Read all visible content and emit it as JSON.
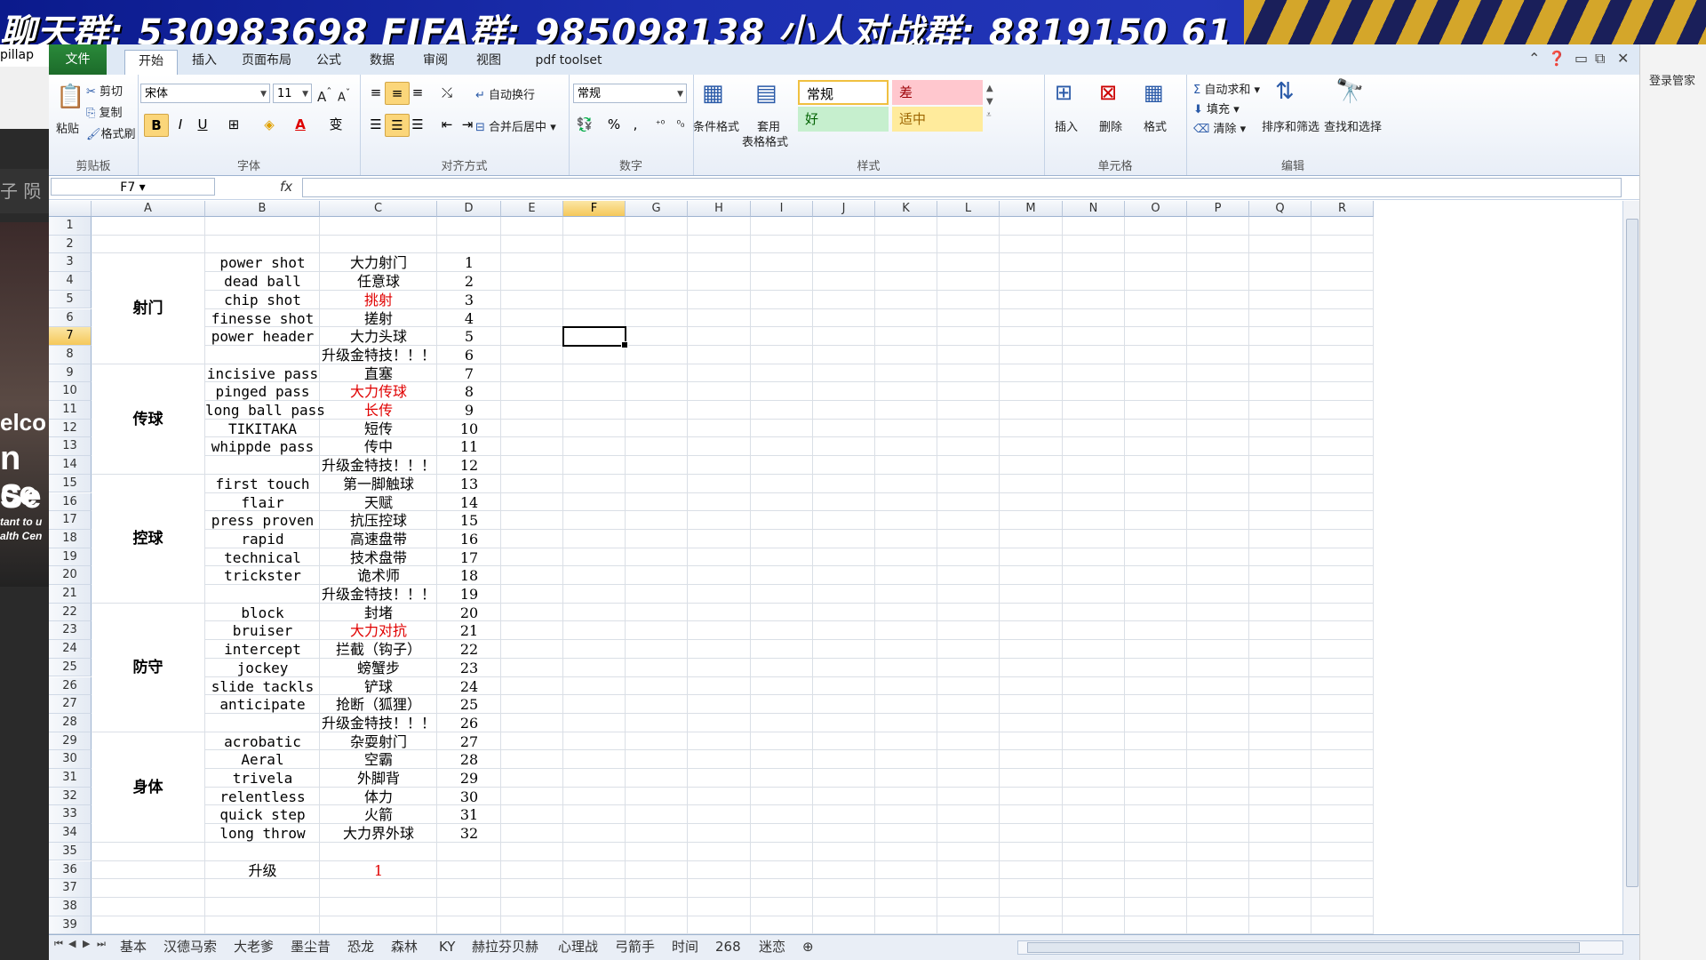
{
  "banner": {
    "text": "聊天群: 530983698   FIFA群: 985098138   小人对战群: 8819150 61"
  },
  "left_bg": {
    "label": "pillap",
    "sidebar_chars": "子  陨",
    "web_text": [
      "elco",
      "n Se",
      "ce",
      "tant to u",
      "alth Cen"
    ]
  },
  "right_bg": {
    "label": "登录管家"
  },
  "ribbon": {
    "file_label": "文件",
    "tabs": [
      "开始",
      "插入",
      "页面布局",
      "公式",
      "数据",
      "审阅",
      "视图",
      "pdf toolset"
    ],
    "active_tab": "开始",
    "clipboard": {
      "paste": "粘贴",
      "cut": "剪切",
      "copy": "复制",
      "format_painter": "格式刷",
      "label": "剪贴板"
    },
    "font": {
      "name": "宋体",
      "size": "11",
      "label": "字体",
      "bold": "B",
      "italic": "I",
      "underline": "U",
      "font_color": "A",
      "wen": "变"
    },
    "alignment": {
      "wrap": "自动换行",
      "merge": "合并后居中",
      "label": "对齐方式"
    },
    "number": {
      "format": "常规",
      "percent": "%",
      "comma": ",",
      "label": "数字"
    },
    "styles": {
      "conditional": "条件格式",
      "table_format_1": "套用",
      "table_format_2": "表格格式",
      "normal": "常规",
      "bad": "差",
      "good": "好",
      "neutral": "适中",
      "label": "样式"
    },
    "cells": {
      "insert": "插入",
      "delete": "删除",
      "format": "格式",
      "label": "单元格"
    },
    "editing": {
      "autosum": "自动求和",
      "fill": "填充",
      "clear": "清除",
      "sort": "排序和筛选",
      "find": "查找和选择",
      "label": "编辑"
    }
  },
  "formula_bar": {
    "name_box": "F7",
    "fx": "fx",
    "value": ""
  },
  "columns": [
    "A",
    "B",
    "C",
    "D",
    "E",
    "F",
    "G",
    "H",
    "I",
    "J",
    "K",
    "L",
    "M",
    "N",
    "O",
    "P",
    "Q",
    "R"
  ],
  "selected_column": "F",
  "selected_row": 7,
  "rows": [
    "1",
    "2",
    "3",
    "4",
    "5",
    "6",
    "7",
    "8",
    "9",
    "10",
    "11",
    "12",
    "13",
    "14",
    "15",
    "16",
    "17",
    "18",
    "19",
    "20",
    "21",
    "22",
    "23",
    "24",
    "25",
    "26",
    "27",
    "28",
    "29",
    "30",
    "31",
    "32",
    "33",
    "34",
    "35",
    "36",
    "37",
    "38",
    "39"
  ],
  "categories": [
    {
      "label": "射门",
      "start": 3,
      "end": 8
    },
    {
      "label": "传球",
      "start": 9,
      "end": 14
    },
    {
      "label": "控球",
      "start": 15,
      "end": 21
    },
    {
      "label": "防守",
      "start": 22,
      "end": 28
    },
    {
      "label": "身体",
      "start": 29,
      "end": 34
    }
  ],
  "cells": [
    {
      "row": 3,
      "b": "power shot",
      "c": "大力射门",
      "d": "1"
    },
    {
      "row": 4,
      "b": "dead ball",
      "c": "任意球",
      "d": "2"
    },
    {
      "row": 5,
      "b": "chip shot",
      "c": "挑射",
      "d": "3",
      "c_red": true
    },
    {
      "row": 6,
      "b": "finesse shot",
      "c": "搓射",
      "d": "4"
    },
    {
      "row": 7,
      "b": "power header",
      "c": "大力头球",
      "d": "5"
    },
    {
      "row": 8,
      "b": "",
      "c": "升级金特技！！！",
      "d": "6"
    },
    {
      "row": 9,
      "b": "incisive pass",
      "c": "直塞",
      "d": "7"
    },
    {
      "row": 10,
      "b": "pinged pass",
      "c": "大力传球",
      "d": "8",
      "c_red": true
    },
    {
      "row": 11,
      "b": "long ball pass",
      "c": "长传",
      "d": "9",
      "c_red": true
    },
    {
      "row": 12,
      "b": "TIKITAKA",
      "c": "短传",
      "d": "10"
    },
    {
      "row": 13,
      "b": "whippde pass",
      "c": "传中",
      "d": "11"
    },
    {
      "row": 14,
      "b": "",
      "c": "升级金特技！！！",
      "d": "12"
    },
    {
      "row": 15,
      "b": "first touch",
      "c": "第一脚触球",
      "d": "13"
    },
    {
      "row": 16,
      "b": "flair",
      "c": "天赋",
      "d": "14"
    },
    {
      "row": 17,
      "b": "press proven",
      "c": "抗压控球",
      "d": "15"
    },
    {
      "row": 18,
      "b": "rapid",
      "c": "高速盘带",
      "d": "16"
    },
    {
      "row": 19,
      "b": "technical",
      "c": "技术盘带",
      "d": "17"
    },
    {
      "row": 20,
      "b": "trickster",
      "c": "诡术师",
      "d": "18"
    },
    {
      "row": 21,
      "b": "",
      "c": "升级金特技！！！",
      "d": "19"
    },
    {
      "row": 22,
      "b": "block",
      "c": "封堵",
      "d": "20"
    },
    {
      "row": 23,
      "b": "bruiser",
      "c": "大力对抗",
      "d": "21",
      "c_red": true
    },
    {
      "row": 24,
      "b": "intercept",
      "c": "拦截（钩子）",
      "d": "22"
    },
    {
      "row": 25,
      "b": "jockey",
      "c": "螃蟹步",
      "d": "23"
    },
    {
      "row": 26,
      "b": "slide tackls",
      "c": "铲球",
      "d": "24"
    },
    {
      "row": 27,
      "b": "anticipate",
      "c": "抢断（狐狸）",
      "d": "25"
    },
    {
      "row": 28,
      "b": "",
      "c": "升级金特技！！！",
      "d": "26"
    },
    {
      "row": 29,
      "b": "acrobatic",
      "c": "杂耍射门",
      "d": "27"
    },
    {
      "row": 30,
      "b": "Aeral",
      "c": "空霸",
      "d": "28"
    },
    {
      "row": 31,
      "b": "trivela",
      "c": "外脚背",
      "d": "29"
    },
    {
      "row": 32,
      "b": "relentless",
      "c": "体力",
      "d": "30"
    },
    {
      "row": 33,
      "b": "quick step",
      "c": "火箭",
      "d": "31"
    },
    {
      "row": 34,
      "b": "long throw",
      "c": "大力界外球",
      "d": "32"
    },
    {
      "row": 36,
      "b": "升级",
      "c": "1",
      "d": "",
      "c_red": true
    }
  ],
  "sheet_tabs": [
    "基本",
    "汉德马索",
    "大老爹",
    "墨尘昔",
    "恐龙",
    "森林",
    "KY",
    "赫拉芬贝赫",
    "心理战",
    "弓箭手",
    "时间",
    "268",
    "迷恋"
  ],
  "colors": {
    "red": "#e00000",
    "selected_header": "#f5c85a",
    "ribbon_blue": "#dfe9f5"
  }
}
